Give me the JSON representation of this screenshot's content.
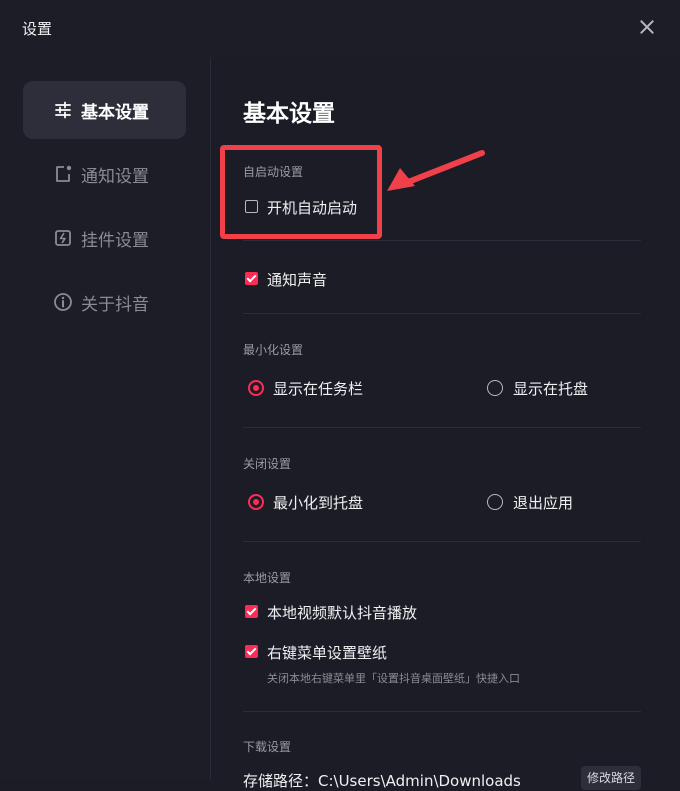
{
  "window": {
    "title": "设置"
  },
  "sidebar": {
    "items": [
      {
        "label": "基本设置",
        "icon": "sliders-icon",
        "active": true
      },
      {
        "label": "通知设置",
        "icon": "notification-icon",
        "active": false
      },
      {
        "label": "挂件设置",
        "icon": "widget-icon",
        "active": false
      },
      {
        "label": "关于抖音",
        "icon": "info-icon",
        "active": false
      }
    ]
  },
  "main": {
    "title": "基本设置",
    "autostart": {
      "section": "自启动设置",
      "option": "开机自动启动",
      "checked": false
    },
    "notify_sound": {
      "label": "通知声音",
      "checked": true
    },
    "minimize": {
      "section": "最小化设置",
      "options": [
        "显示在任务栏",
        "显示在托盘"
      ],
      "selected": "显示在任务栏"
    },
    "close": {
      "section": "关闭设置",
      "options": [
        "最小化到托盘",
        "退出应用"
      ],
      "selected": "最小化到托盘"
    },
    "local": {
      "section": "本地设置",
      "option1": {
        "label": "本地视频默认抖音播放",
        "checked": true
      },
      "option2": {
        "label": "右键菜单设置壁纸",
        "checked": true
      },
      "hint": "关闭本地右键菜单里「设置抖音桌面壁纸」快捷入口"
    },
    "download": {
      "section": "下载设置",
      "path_label": "存储路径：C:\\Users\\Admin\\Downloads",
      "change_button": "修改路径"
    }
  },
  "colors": {
    "accent": "#fe2c55",
    "annotation": "#f0414b",
    "background": "#1b1c25"
  }
}
